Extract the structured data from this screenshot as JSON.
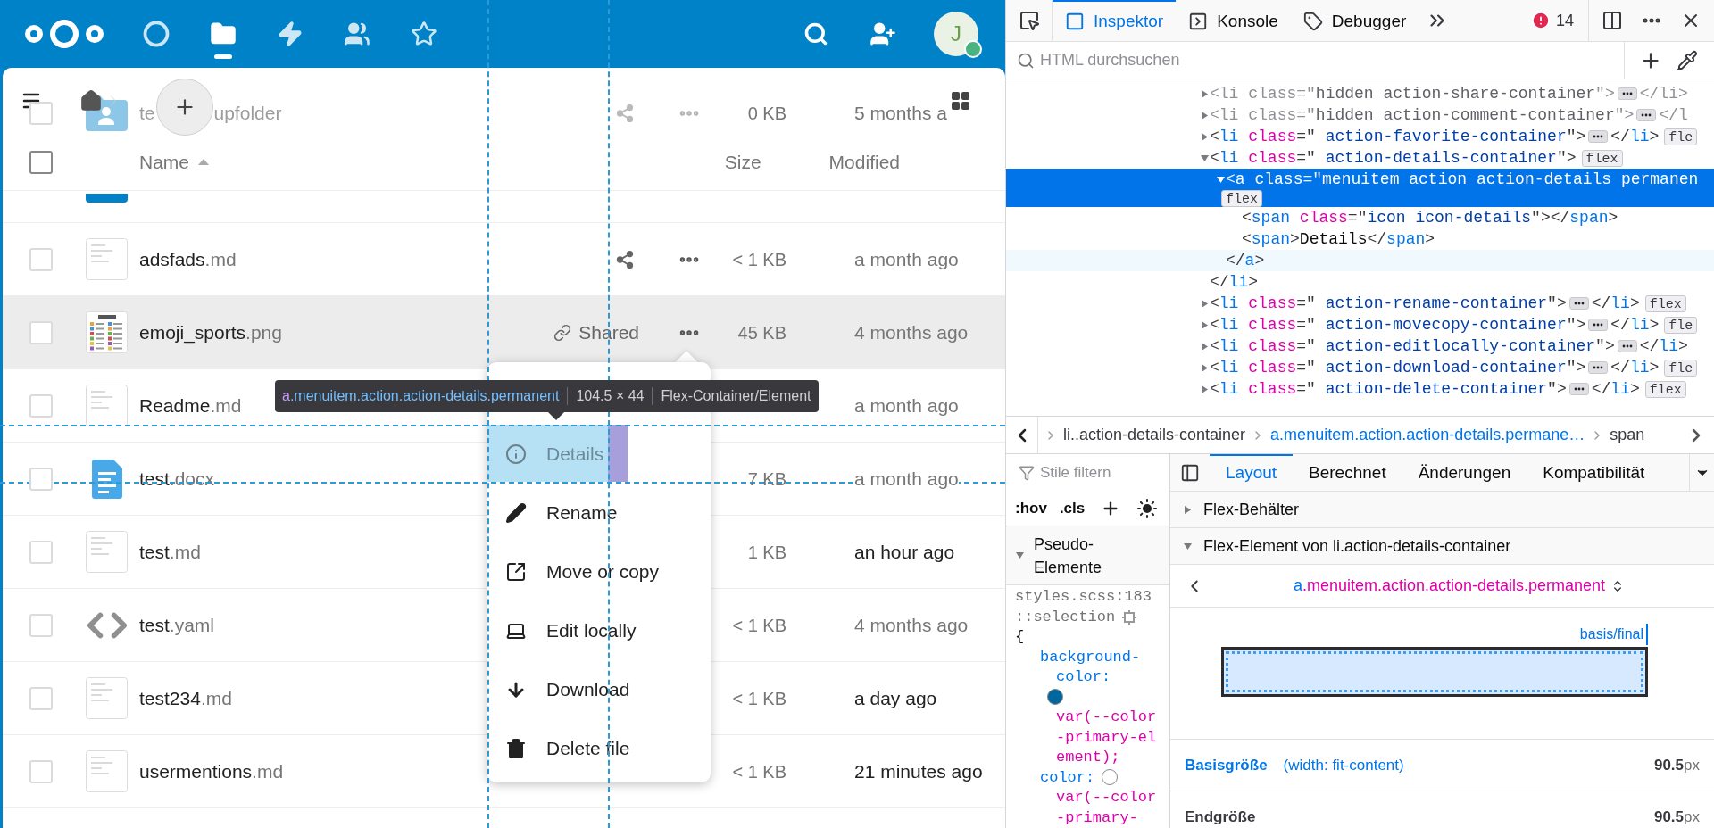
{
  "header": {
    "nav": [
      {
        "kind": "dashboard",
        "selected": false
      },
      {
        "kind": "files",
        "selected": true
      },
      {
        "kind": "activity",
        "selected": false
      },
      {
        "kind": "contacts",
        "selected": false
      },
      {
        "kind": "circles",
        "selected": false
      }
    ],
    "avatar": {
      "initial": "J",
      "status": {
        "color": "#49b382"
      }
    }
  },
  "files": {
    "columns": {
      "name": "Name",
      "size": "Size",
      "modified": "Modified"
    },
    "select_all": {
      "checked": false
    },
    "rows": [
      {
        "kind": "file",
        "name": "te",
        "name_tail": "upfolder",
        "ext": "",
        "thumbnail": {
          "kind": "shared-folder"
        },
        "action": {
          "kind": "share"
        },
        "size": "0 KB",
        "modified": "5 months a",
        "recent": false,
        "checked": false
      },
      {
        "kind": "partial",
        "thumbnail": {
          "kind": "folder"
        }
      },
      {
        "kind": "file",
        "name": "adsfads",
        "ext": ".md",
        "thumbnail": {
          "kind": "doc"
        },
        "action": {
          "kind": "share"
        },
        "size": "< 1 KB",
        "modified": "a month ago",
        "recent": false,
        "highlighted": false,
        "checked": false
      },
      {
        "kind": "file",
        "name": "emoji_sports",
        "ext": ".png",
        "thumbnail": {
          "kind": "image"
        },
        "action": {
          "kind": "shared"
        },
        "shared_label": "Shared",
        "size": "45 KB",
        "modified": "4 months ago",
        "recent": false,
        "highlighted": true,
        "checked": false
      },
      {
        "kind": "file",
        "name": "Readme",
        "ext": ".md",
        "thumbnail": {
          "kind": "doc"
        },
        "modified": "a month ago",
        "recent": false,
        "highlighted": false,
        "checked": false
      },
      {
        "kind": "file",
        "name": "test",
        "ext": ".docx",
        "thumbnail": {
          "kind": "docx"
        },
        "size": "7 KB",
        "modified": "a month ago",
        "recent": false,
        "highlighted": false,
        "checked": false
      },
      {
        "kind": "file",
        "name": "test",
        "ext": ".md",
        "thumbnail": {
          "kind": "doc"
        },
        "size": "1 KB",
        "modified": "an hour ago",
        "recent": true,
        "highlighted": false,
        "checked": false
      },
      {
        "kind": "file",
        "name": "test",
        "ext": ".yaml",
        "thumbnail": {
          "kind": "code"
        },
        "size": "< 1 KB",
        "modified": "4 months ago",
        "recent": false,
        "highlighted": false,
        "checked": false
      },
      {
        "kind": "file",
        "name": "test234",
        "ext": ".md",
        "thumbnail": {
          "kind": "doc"
        },
        "size": "< 1 KB",
        "modified": "a day ago",
        "recent": true,
        "highlighted": false,
        "checked": false
      },
      {
        "kind": "file",
        "name": "usermentions",
        "ext": ".md",
        "thumbnail": {
          "kind": "doc"
        },
        "size": "< 1 KB",
        "modified": "21 minutes ago",
        "recent": true,
        "highlighted": false,
        "checked": false
      }
    ]
  },
  "menu": {
    "items": [
      {
        "label": "Details",
        "kind": "details",
        "inspected": true
      },
      {
        "label": "Rename",
        "kind": "rename",
        "inspected": false
      },
      {
        "label": "Move or copy",
        "kind": "move",
        "inspected": false
      },
      {
        "label": "Edit locally",
        "kind": "edit-locally",
        "inspected": false
      },
      {
        "label": "Download",
        "kind": "download",
        "inspected": false
      },
      {
        "label": "Delete file",
        "kind": "delete",
        "inspected": false
      }
    ]
  },
  "tooltip": {
    "tag": "a",
    "classes": ".menuitem.action.action-details.permanent",
    "dimensions": "104.5 × 44",
    "type": "Flex-Container/Element"
  },
  "devtools": {
    "tabs": [
      {
        "label": "Inspektor",
        "kind": "inspector",
        "selected": true
      },
      {
        "label": "Konsole",
        "kind": "console",
        "selected": false
      },
      {
        "label": "Debugger",
        "kind": "debugger",
        "selected": false
      }
    ],
    "error_count": "14",
    "search": {
      "placeholder": "HTML durchsuchen"
    },
    "markup": [
      {
        "tokens": [
          {
            "text": "<",
            "kind": "p"
          },
          {
            "text": "li",
            "kind": "tag"
          },
          {
            "text": " class",
            "kind": "attr"
          },
          {
            "text": "=\"",
            "kind": "p"
          },
          {
            "text": "hidden action-share-container",
            "kind": "val"
          },
          {
            "text": "\">",
            "kind": "p"
          }
        ],
        "close": [
          {
            "text": "</",
            "kind": "p"
          },
          {
            "text": "li",
            "kind": "tag"
          },
          {
            "text": ">",
            "kind": "p"
          }
        ],
        "expanded": false,
        "hidden": true,
        "selected": false
      },
      {
        "tokens": [
          {
            "text": "<",
            "kind": "p"
          },
          {
            "text": "li",
            "kind": "tag"
          },
          {
            "text": " class",
            "kind": "attr"
          },
          {
            "text": "=\"",
            "kind": "p"
          },
          {
            "text": "hidden action-comment-container",
            "kind": "val"
          },
          {
            "text": "\">",
            "kind": "p"
          }
        ],
        "close": [
          {
            "text": "</",
            "kind": "p"
          },
          {
            "text": "l",
            "kind": "tag"
          }
        ],
        "expanded": false,
        "hidden": true,
        "selected": false
      },
      {
        "tokens": [
          {
            "text": "<",
            "kind": "p"
          },
          {
            "text": "li",
            "kind": "tag"
          },
          {
            "text": " class",
            "kind": "attr"
          },
          {
            "text": "=\"",
            "kind": "p"
          },
          {
            "text": " action-favorite-container",
            "kind": "val"
          },
          {
            "text": "\">",
            "kind": "p"
          }
        ],
        "close": [
          {
            "text": "</",
            "kind": "p"
          },
          {
            "text": "li",
            "kind": "tag"
          },
          {
            "text": ">",
            "kind": "p"
          }
        ],
        "badge": "fle",
        "expanded": false,
        "hidden": false,
        "selected": false
      },
      {
        "tokens": [
          {
            "text": "<",
            "kind": "p"
          },
          {
            "text": "li",
            "kind": "tag"
          },
          {
            "text": " class",
            "kind": "attr"
          },
          {
            "text": "=\"",
            "kind": "p"
          },
          {
            "text": " action-details-container",
            "kind": "val"
          },
          {
            "text": "\">",
            "kind": "p"
          }
        ],
        "close": [
          {
            "text": "</",
            "kind": "p"
          },
          {
            "text": "li",
            "kind": "tag"
          },
          {
            "text": ">",
            "kind": "p"
          }
        ],
        "badge": "flex",
        "expanded": true,
        "hidden": false,
        "selected": false,
        "children": [
          {
            "tokens": [
              {
                "text": "<",
                "kind": "p"
              },
              {
                "text": "a",
                "kind": "tag"
              },
              {
                "text": " class",
                "kind": "attr"
              },
              {
                "text": "=\"",
                "kind": "p"
              },
              {
                "text": "menuitem action action-details permanen",
                "kind": "val"
              }
            ],
            "close": [
              {
                "text": "</",
                "kind": "p"
              },
              {
                "text": "a",
                "kind": "tag"
              },
              {
                "text": ">",
                "kind": "p"
              }
            ],
            "close_hovered": true,
            "badge": "flex",
            "expanded": true,
            "hidden": false,
            "selected": true,
            "children": [
              {
                "tokens": [
                  {
                    "text": "<",
                    "kind": "p"
                  },
                  {
                    "text": "span",
                    "kind": "tag"
                  },
                  {
                    "text": " class",
                    "kind": "attr"
                  },
                  {
                    "text": "=\"",
                    "kind": "p"
                  },
                  {
                    "text": "icon icon-details",
                    "kind": "val"
                  },
                  {
                    "text": "\">",
                    "kind": "p"
                  },
                  {
                    "text": "</",
                    "kind": "p"
                  },
                  {
                    "text": "span",
                    "kind": "tag"
                  },
                  {
                    "text": ">",
                    "kind": "p"
                  }
                ],
                "hidden": false,
                "selected": false
              },
              {
                "tokens": [
                  {
                    "text": "<",
                    "kind": "p"
                  },
                  {
                    "text": "span",
                    "kind": "tag"
                  },
                  {
                    "text": ">",
                    "kind": "p"
                  },
                  {
                    "text": "Details",
                    "kind": "text"
                  },
                  {
                    "text": "</",
                    "kind": "p"
                  },
                  {
                    "text": "span",
                    "kind": "tag"
                  },
                  {
                    "text": ">",
                    "kind": "p"
                  }
                ],
                "hidden": false,
                "selected": false
              }
            ]
          }
        ]
      },
      {
        "tokens": [
          {
            "text": "<",
            "kind": "p"
          },
          {
            "text": "li",
            "kind": "tag"
          },
          {
            "text": " class",
            "kind": "attr"
          },
          {
            "text": "=\"",
            "kind": "p"
          },
          {
            "text": " action-rename-container",
            "kind": "val"
          },
          {
            "text": "\">",
            "kind": "p"
          }
        ],
        "close": [
          {
            "text": "</",
            "kind": "p"
          },
          {
            "text": "li",
            "kind": "tag"
          },
          {
            "text": ">",
            "kind": "p"
          }
        ],
        "badge": "flex",
        "expanded": false,
        "hidden": false,
        "selected": false
      },
      {
        "tokens": [
          {
            "text": "<",
            "kind": "p"
          },
          {
            "text": "li",
            "kind": "tag"
          },
          {
            "text": " class",
            "kind": "attr"
          },
          {
            "text": "=\"",
            "kind": "p"
          },
          {
            "text": " action-movecopy-container",
            "kind": "val"
          },
          {
            "text": "\">",
            "kind": "p"
          }
        ],
        "close": [
          {
            "text": "</",
            "kind": "p"
          },
          {
            "text": "li",
            "kind": "tag"
          },
          {
            "text": ">",
            "kind": "p"
          }
        ],
        "badge": "fle",
        "expanded": false,
        "hidden": false,
        "selected": false
      },
      {
        "tokens": [
          {
            "text": "<",
            "kind": "p"
          },
          {
            "text": "li",
            "kind": "tag"
          },
          {
            "text": " class",
            "kind": "attr"
          },
          {
            "text": "=\"",
            "kind": "p"
          },
          {
            "text": " action-editlocally-container",
            "kind": "val"
          },
          {
            "text": "\">",
            "kind": "p"
          }
        ],
        "close": [
          {
            "text": "</",
            "kind": "p"
          },
          {
            "text": "li",
            "kind": "tag"
          },
          {
            "text": ">",
            "kind": "p"
          }
        ],
        "expanded": false,
        "hidden": false,
        "selected": false
      },
      {
        "tokens": [
          {
            "text": "<",
            "kind": "p"
          },
          {
            "text": "li",
            "kind": "tag"
          },
          {
            "text": " class",
            "kind": "attr"
          },
          {
            "text": "=\"",
            "kind": "p"
          },
          {
            "text": " action-download-container",
            "kind": "val"
          },
          {
            "text": "\">",
            "kind": "p"
          }
        ],
        "close": [
          {
            "text": "</",
            "kind": "p"
          },
          {
            "text": "li",
            "kind": "tag"
          },
          {
            "text": ">",
            "kind": "p"
          }
        ],
        "badge": "fle",
        "expanded": false,
        "hidden": false,
        "selected": false
      },
      {
        "tokens": [
          {
            "text": "<",
            "kind": "p"
          },
          {
            "text": "li",
            "kind": "tag"
          },
          {
            "text": " class",
            "kind": "attr"
          },
          {
            "text": "=\"",
            "kind": "p"
          },
          {
            "text": " action-delete-container",
            "kind": "val"
          },
          {
            "text": "\">",
            "kind": "p"
          }
        ],
        "close": [
          {
            "text": "</",
            "kind": "p"
          },
          {
            "text": "li",
            "kind": "tag"
          },
          {
            "text": ">",
            "kind": "p"
          }
        ],
        "badge": "flex",
        "expanded": false,
        "hidden": false,
        "selected": false
      }
    ],
    "breadcrumbs": [
      {
        "label": "li..action-details-container",
        "selected": false
      },
      {
        "label": "a.menuitem.action.action-details.permane…",
        "selected": true
      },
      {
        "label": "span",
        "selected": false
      }
    ],
    "rules": {
      "filter_placeholder": "Stile filtern",
      "hov": ":hov",
      "cls": ".cls",
      "pseudo_heading": "Pseudo-Elemente",
      "pseudo_expanded": true,
      "source": "styles.scss:183",
      "selector": "::selection",
      "open_brace": "{",
      "declarations": [
        {
          "property": "background-color:",
          "value": "var(--color-primary-element);",
          "color": "#00679e"
        },
        {
          "property": "color:",
          "value": "var(--color-primary-",
          "color": "#ffffff"
        }
      ]
    },
    "layout": {
      "tabs": [
        {
          "label": "Layout",
          "selected": true
        },
        {
          "label": "Berechnet",
          "selected": false
        },
        {
          "label": "Änderungen",
          "selected": false
        },
        {
          "label": "Kompatibilität",
          "selected": false
        }
      ],
      "sections": [
        {
          "title": "Flex-Behälter",
          "expanded": false
        },
        {
          "title": "Flex-Element von li.action-details-container",
          "expanded": true
        }
      ],
      "element_tag": "a",
      "element_classes": ".menuitem.action.action-details.permanent",
      "basis_label": "basis/final",
      "sizes": [
        {
          "label": "Basisgröße",
          "note": "(width: fit-content)",
          "value": "90.5",
          "unit": "px",
          "kind": "basis"
        },
        {
          "label": "Endgröße",
          "value": "90.5",
          "unit": "px",
          "kind": "final"
        }
      ]
    }
  }
}
